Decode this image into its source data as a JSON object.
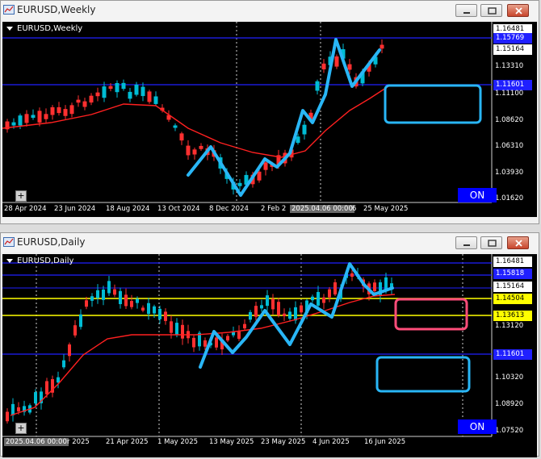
{
  "weekly": {
    "window_title": "EURUSD,Weekly",
    "chart_label": "EURUSD,Weekly",
    "on_label": "ON",
    "plus_label": "+",
    "price_labels": [
      {
        "text": "1.16481",
        "style": "white"
      },
      {
        "text": "1.15769",
        "style": "blue"
      },
      {
        "text": "1.15164",
        "style": "white"
      },
      {
        "text": "1.11601",
        "style": "blue"
      }
    ],
    "y_axis": [
      "1.13310",
      "1.11100",
      "1.08620",
      "1.06310",
      "1.03930",
      "1.01620"
    ],
    "x_axis": [
      "28 Apr 2024",
      "23 Jun 2024",
      "18 Aug 2024",
      "13 Oct 2024",
      "8 Dec 2024",
      "2 Feb 2"
    ],
    "x_axis_tail": [
      "6",
      "25 May 2025"
    ],
    "crosshair_time": "2025.04.06 00:00"
  },
  "daily": {
    "window_title": "EURUSD,Daily",
    "chart_label": "EURUSD,Daily",
    "on_label": "ON",
    "plus_label": "+",
    "price_labels": [
      {
        "text": "1.16481",
        "style": "white"
      },
      {
        "text": "1.15818",
        "style": "blue"
      },
      {
        "text": "1.15164",
        "style": "white"
      },
      {
        "text": "1.14504",
        "style": "yellow"
      },
      {
        "text": "1.13613",
        "style": "yellow"
      },
      {
        "text": "1.11601",
        "style": "blue"
      }
    ],
    "y_axis": [
      "1.13120",
      "1.10320",
      "1.08920",
      "1.07520"
    ],
    "x_axis": [
      "r 2025",
      "21 Apr 2025",
      "1 May 2025",
      "13 May 2025",
      "23 May 2025",
      "4 Jun 2025",
      "16 Jun 2025"
    ],
    "crosshair_time": "2025.04.06 00:00"
  },
  "colors": {
    "chart_bg": "#000000",
    "bull_candle": "#00bcd4",
    "bear_candle": "#ff3030",
    "moving_average": "#ff2020",
    "hline_blue": "#2020ff",
    "hline_yellow": "#ffff00",
    "drawing_cyan": "#29b6f6",
    "box_cyan": "#29b6f6",
    "box_pink": "#ff4d7a",
    "on_button": "#0000ff"
  }
}
